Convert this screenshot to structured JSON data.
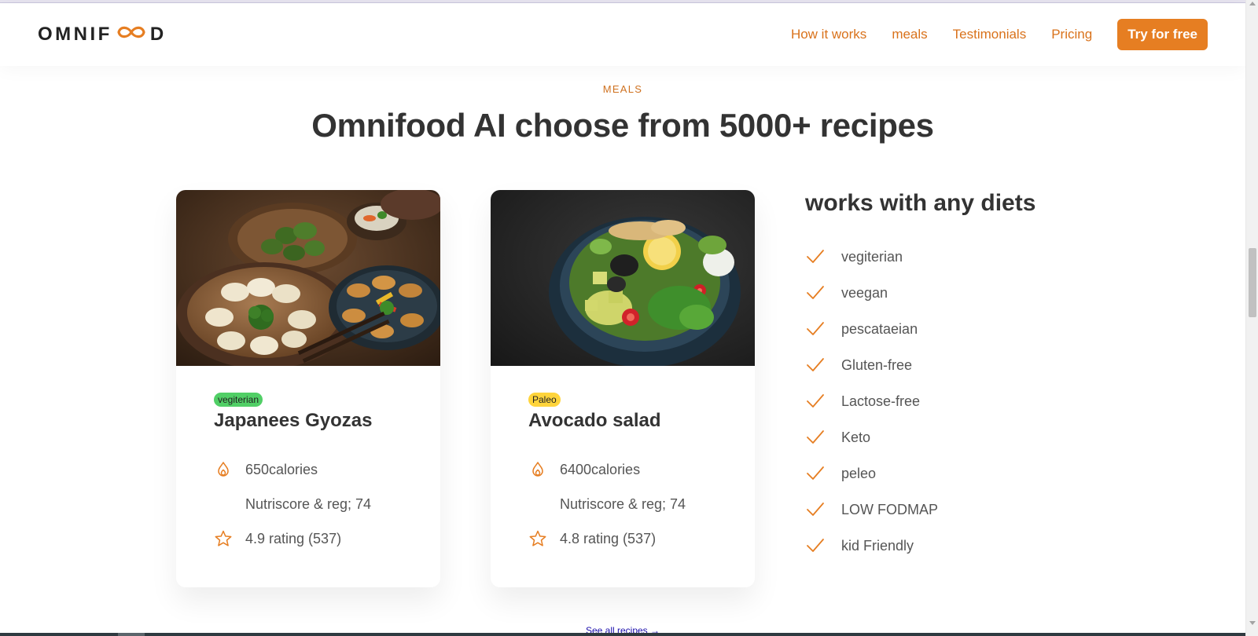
{
  "header": {
    "logo_text_left": "OMNIF",
    "logo_text_right": "D",
    "nav": [
      "How it works",
      "meals",
      "Testimonials",
      "Pricing"
    ],
    "cta": "Try for free",
    "accent_color": "#e67e22"
  },
  "section": {
    "subheading": "MEALS",
    "heading": "Omnifood AI choose from 5000+ recipes"
  },
  "meals": [
    {
      "tag": "vegiterian",
      "tag_color": "#51cf66",
      "title": "Japanees Gyozas",
      "calories": "650calories",
      "nutriscore": "Nutriscore & reg; 74",
      "rating": "4.9 rating (537)",
      "image": "gyoza-photo"
    },
    {
      "tag": "Paleo",
      "tag_color": "#ffd43b",
      "title": "Avocado salad",
      "calories": "6400calories",
      "nutriscore": "Nutriscore & reg; 74",
      "rating": "4.8 rating (537)",
      "image": "avocado-salad-photo"
    }
  ],
  "diets": {
    "title": "works with any diets",
    "items": [
      "vegiterian",
      "veegan",
      "pescataeian",
      "Gluten-free",
      "Lactose-free",
      "Keto",
      "peleo",
      "LOW FODMAP",
      "kid Friendly"
    ]
  },
  "see_all": "See all recipes →"
}
